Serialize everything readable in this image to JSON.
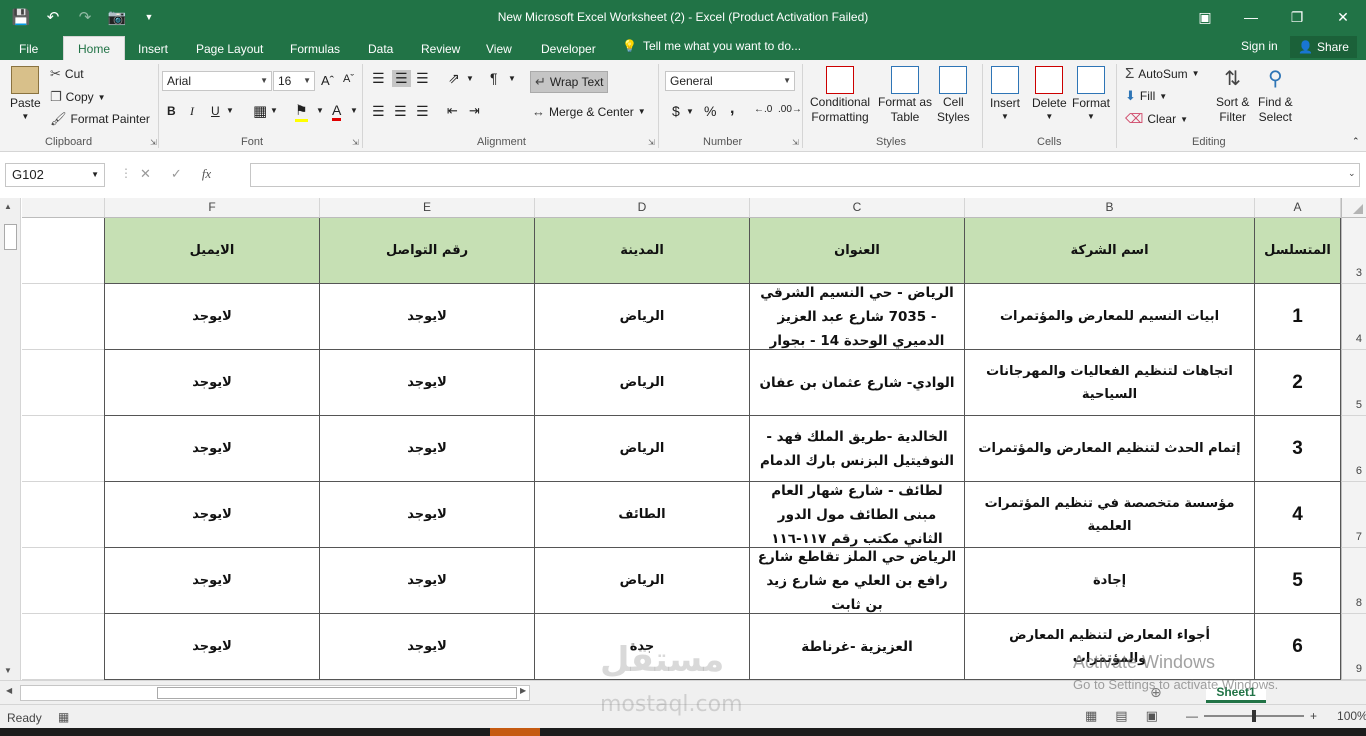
{
  "window": {
    "title": "New Microsoft Excel Worksheet (2) - Excel (Product Activation Failed)",
    "controls": [
      "restore-ribbon",
      "minimize",
      "maximize",
      "close"
    ]
  },
  "tabs": [
    "File",
    "Home",
    "Insert",
    "Page Layout",
    "Formulas",
    "Data",
    "Review",
    "View",
    "Developer"
  ],
  "active_tab": "Home",
  "tell_me": "Tell me what you want to do...",
  "sign_in": "Sign in",
  "share": "Share",
  "ribbon": {
    "clipboard": {
      "label": "Clipboard",
      "paste": "Paste",
      "cut": "Cut",
      "copy": "Copy",
      "format_painter": "Format Painter"
    },
    "font": {
      "label": "Font",
      "name": "Arial",
      "size": "16",
      "bold": "B",
      "italic": "I",
      "underline": "U"
    },
    "alignment": {
      "label": "Alignment",
      "wrap_text": "Wrap Text",
      "merge_center": "Merge & Center"
    },
    "number": {
      "label": "Number",
      "format": "General",
      "currency": "$",
      "percent": "%",
      "comma": ","
    },
    "styles": {
      "label": "Styles",
      "conditional": [
        "Conditional",
        "Formatting"
      ],
      "format_table": [
        "Format as",
        "Table"
      ],
      "cell_styles": [
        "Cell",
        "Styles"
      ]
    },
    "cells": {
      "label": "Cells",
      "insert": "Insert",
      "delete": "Delete",
      "format": "Format"
    },
    "editing": {
      "label": "Editing",
      "autosum": "AutoSum",
      "fill": "Fill",
      "clear": "Clear",
      "sort": [
        "Sort &",
        "Filter"
      ],
      "find": [
        "Find &",
        "Select"
      ]
    }
  },
  "formula_bar": {
    "name_box": "G102",
    "fx": "fx",
    "value": ""
  },
  "columns": [
    "A",
    "B",
    "C",
    "D",
    "E",
    "F"
  ],
  "row_numbers": [
    "3",
    "4",
    "5",
    "6",
    "7",
    "8",
    "9"
  ],
  "table": {
    "headers": [
      "المتسلسل",
      "اسم الشركة",
      "العنوان",
      "المدينة",
      "رقم التواصل",
      "الايميل"
    ],
    "rows": [
      [
        "1",
        "ابيات النسيم للمعارض والمؤتمرات",
        "الرياض - حي النسيم الشرقي - 7035 شارع عبد العزيز الدميري الوحدة 14 - بجوار",
        "الرياض",
        "لايوجد",
        "لايوجد"
      ],
      [
        "2",
        "اتجاهات لتنظيم الفعاليات والمهرجانات السياحية",
        "الوادي- شارع عثمان بن عفان",
        "الرياض",
        "لايوجد",
        "لايوجد"
      ],
      [
        "3",
        "إتمام الحدث لتنظيم المعارض والمؤتمرات",
        "الخالدية -طريق الملك فهد - النوفيتيل البزنس بارك الدمام",
        "الرياض",
        "لايوجد",
        "لايوجد"
      ],
      [
        "4",
        "مؤسسة متخصصة في تنظيم المؤتمرات العلمية",
        "لطائف - شارع شهار العام مبنى الطائف مول الدور الثاني مكتب رقم ١١٧-١١٦",
        "الطائف",
        "لايوجد",
        "لايوجد"
      ],
      [
        "5",
        "إجادة",
        "الرياض حي الملز تقاطع شارع رافع بن العلي مع شارع زيد بن ثابت",
        "الرياض",
        "لايوجد",
        "لايوجد"
      ],
      [
        "6",
        "أجواء المعارض لتنظيم المعارض والمؤتمرات",
        "العزيزية -غرناطة",
        "جدة",
        "لايوجد",
        "لايوجد"
      ]
    ]
  },
  "sheet_tab": "Sheet1",
  "status": {
    "ready": "Ready",
    "zoom": "100%"
  },
  "overlay": {
    "activate_title": "Activate Windows",
    "activate_sub": "Go to Settings to activate Windows.",
    "watermark": "مستقل",
    "watermark_url": "mostaql.com"
  },
  "colors": {
    "excel_green": "#217346",
    "header_fill": "#c6e0b4"
  }
}
